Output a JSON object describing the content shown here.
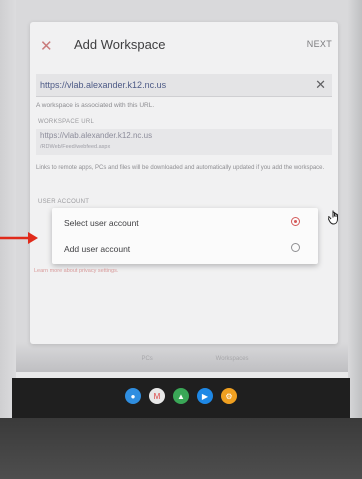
{
  "dialog": {
    "title": "Add Workspace",
    "next_label": "NEXT",
    "close_glyph": "✕",
    "url_value": "https://vlab.alexander.k12.nc.us",
    "clear_glyph": "✕",
    "helper_text": "A workspace is associated with this URL.",
    "workspace_url_label": "WORKSPACE URL",
    "workspace_url_line1": "https://vlab.alexander.k12.nc.us",
    "workspace_url_line2": "/RDWeb/Feed/webfeed.aspx",
    "links_note": "Links to remote apps, PCs and files will be downloaded and automatically updated if you add the workspace.",
    "user_account_label": "USER ACCOUNT",
    "privacy_link": "Learn more about privacy settings."
  },
  "account_popup": {
    "options": [
      {
        "label": "Select user account",
        "selected": true
      },
      {
        "label": "Add user account",
        "selected": false
      }
    ]
  },
  "background_tabs": [
    {
      "label": "PCs"
    },
    {
      "label": "Workspaces"
    }
  ],
  "shelf_icons": [
    {
      "icon": "chrome-icon",
      "color": "#2f8ee0"
    },
    {
      "icon": "gmail-icon",
      "color": "#e8e8e8"
    },
    {
      "icon": "drive-icon",
      "color": "#3aa757"
    },
    {
      "icon": "play-icon",
      "color": "#1e88e5"
    },
    {
      "icon": "settings-icon",
      "color": "#f0a020"
    }
  ],
  "colors": {
    "accent": "#d45a5a",
    "annotation_arrow": "#e02a1a"
  }
}
